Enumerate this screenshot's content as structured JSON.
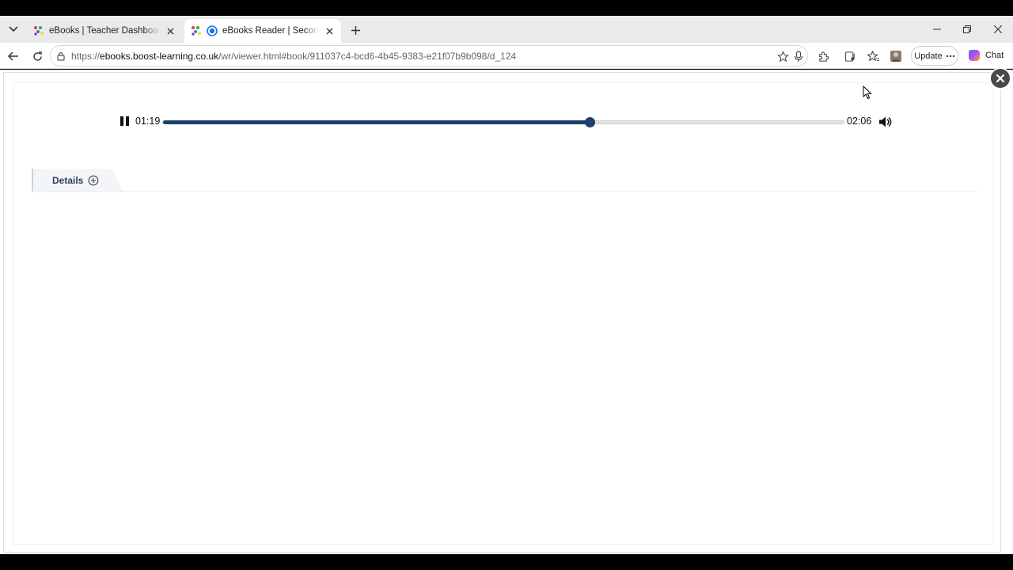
{
  "browser": {
    "tabs": [
      {
        "title": "eBooks | Teacher Dashboard | Boo",
        "active": false
      },
      {
        "title": "eBooks Reader | Secondary St",
        "active": true
      }
    ],
    "url": {
      "scheme": "https://",
      "host": "ebooks.boost-learning.co.uk",
      "path": "/wr/viewer.html#book/911037c4-bcd6-4b45-9383-e21f07b9b098/d_124"
    },
    "update_label": "Update",
    "chat_label": "Chat"
  },
  "player": {
    "state": "playing",
    "current_time": "01:19",
    "total_time": "02:06",
    "progress_fraction": 0.627,
    "colors": {
      "accent": "#1f3f6d",
      "track": "#e3e3e3"
    }
  },
  "details": {
    "label": "Details"
  }
}
